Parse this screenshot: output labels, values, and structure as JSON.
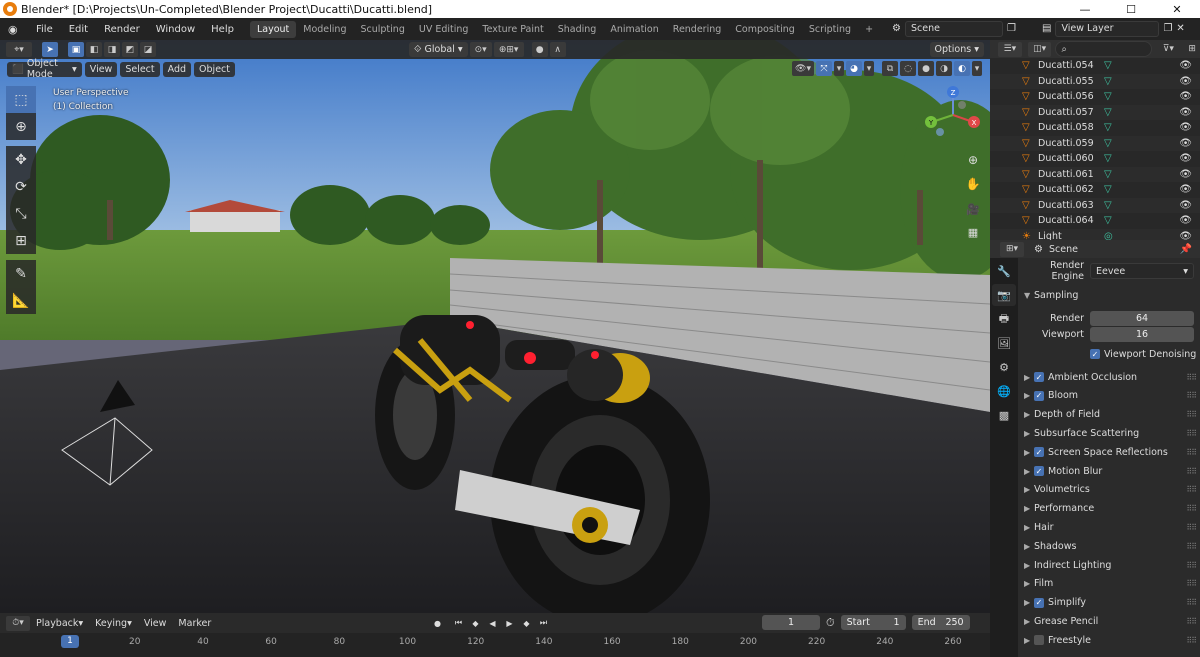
{
  "window": {
    "title": "Blender* [D:\\Projects\\Un-Completed\\Blender Project\\Ducatti\\Ducatti.blend]",
    "minimize": "—",
    "maximize": "☐",
    "close": "✕"
  },
  "menu": {
    "items": [
      "File",
      "Edit",
      "Render",
      "Window",
      "Help"
    ]
  },
  "workspaces": {
    "items": [
      "Layout",
      "Modeling",
      "Sculpting",
      "UV Editing",
      "Texture Paint",
      "Shading",
      "Animation",
      "Rendering",
      "Compositing",
      "Scripting"
    ],
    "active": "Layout",
    "add": "+"
  },
  "scene": {
    "name": "Scene"
  },
  "view_layer": {
    "name": "View Layer"
  },
  "viewport": {
    "mode": "Object Mode",
    "menus": [
      "View",
      "Select",
      "Add",
      "Object"
    ],
    "orientation": "Global",
    "options": "Options",
    "info_line1": "User Perspective",
    "info_line2": "(1) Collection"
  },
  "gizmo": {
    "x": "X",
    "y": "Y",
    "z": "Z"
  },
  "outliner": {
    "items": [
      {
        "name": "Ducatti.054"
      },
      {
        "name": "Ducatti.055"
      },
      {
        "name": "Ducatti.056"
      },
      {
        "name": "Ducatti.057"
      },
      {
        "name": "Ducatti.058"
      },
      {
        "name": "Ducatti.059"
      },
      {
        "name": "Ducatti.060"
      },
      {
        "name": "Ducatti.061"
      },
      {
        "name": "Ducatti.062"
      },
      {
        "name": "Ducatti.063"
      },
      {
        "name": "Ducatti.064"
      },
      {
        "name": "Light"
      }
    ]
  },
  "properties": {
    "context": "Scene",
    "render_engine_label": "Render Engine",
    "render_engine": "Eevee",
    "sampling": "Sampling",
    "render_label": "Render",
    "render_samples": "64",
    "viewport_label": "Viewport",
    "viewport_samples": "16",
    "viewport_denoising": "Viewport Denoising",
    "panels": [
      {
        "label": "Ambient Occlusion",
        "checkbox": true,
        "checked": true
      },
      {
        "label": "Bloom",
        "checkbox": true,
        "checked": true
      },
      {
        "label": "Depth of Field",
        "checkbox": false
      },
      {
        "label": "Subsurface Scattering",
        "checkbox": false
      },
      {
        "label": "Screen Space Reflections",
        "checkbox": true,
        "checked": true
      },
      {
        "label": "Motion Blur",
        "checkbox": true,
        "checked": true
      },
      {
        "label": "Volumetrics",
        "checkbox": false
      },
      {
        "label": "Performance",
        "checkbox": false
      },
      {
        "label": "Hair",
        "checkbox": false
      },
      {
        "label": "Shadows",
        "checkbox": false
      },
      {
        "label": "Indirect Lighting",
        "checkbox": false
      },
      {
        "label": "Film",
        "checkbox": false
      },
      {
        "label": "Simplify",
        "checkbox": true,
        "checked": true
      },
      {
        "label": "Grease Pencil",
        "checkbox": false
      },
      {
        "label": "Freestyle",
        "checkbox": true,
        "checked": false
      }
    ]
  },
  "timeline": {
    "menus": [
      "Playback",
      "Keying",
      "View",
      "Marker"
    ],
    "current_frame": "1",
    "start_label": "Start",
    "start": "1",
    "end_label": "End",
    "end": "250",
    "ticks": [
      "1",
      "20",
      "40",
      "60",
      "80",
      "100",
      "120",
      "140",
      "160",
      "180",
      "200",
      "220",
      "240",
      "260"
    ]
  }
}
